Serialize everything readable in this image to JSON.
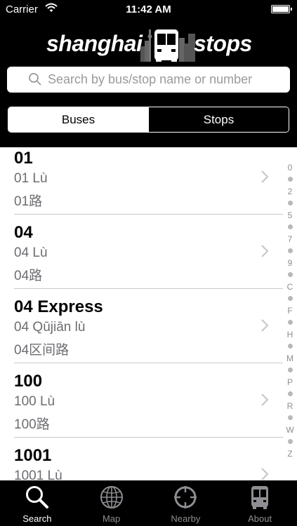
{
  "status_bar": {
    "carrier": "Carrier",
    "time": "11:42 AM"
  },
  "header": {
    "logo_left": "shanghai",
    "logo_right": "stops"
  },
  "search": {
    "placeholder": "Search by bus/stop name or number"
  },
  "segmented": {
    "buses": "Buses",
    "stops": "Stops",
    "selected": "Buses"
  },
  "routes": [
    {
      "number": "01",
      "pinyin": "01 Lù",
      "chinese": "01路"
    },
    {
      "number": "04",
      "pinyin": "04 Lù",
      "chinese": "04路"
    },
    {
      "number": "04 Express",
      "pinyin": "04 Qūjiān lù",
      "chinese": "04区间路"
    },
    {
      "number": "100",
      "pinyin": "100 Lù",
      "chinese": "100路"
    },
    {
      "number": "1001",
      "pinyin": "1001 Lù",
      "chinese": ""
    }
  ],
  "index": [
    "0",
    "•",
    "2",
    "•",
    "5",
    "•",
    "7",
    "•",
    "9",
    "•",
    "C",
    "•",
    "F",
    "•",
    "H",
    "•",
    "M",
    "•",
    "P",
    "•",
    "R",
    "•",
    "W",
    "•",
    "Z"
  ],
  "tabs": [
    {
      "label": "Search",
      "icon": "search-icon",
      "active": true
    },
    {
      "label": "Map",
      "icon": "globe-icon",
      "active": false
    },
    {
      "label": "Nearby",
      "icon": "crosshair-icon",
      "active": false
    },
    {
      "label": "About",
      "icon": "bus-icon",
      "active": false
    }
  ],
  "colors": {
    "header_bg": "#000000",
    "secondary_text": "#6d6d72",
    "inactive_tab": "#8e8e93"
  }
}
